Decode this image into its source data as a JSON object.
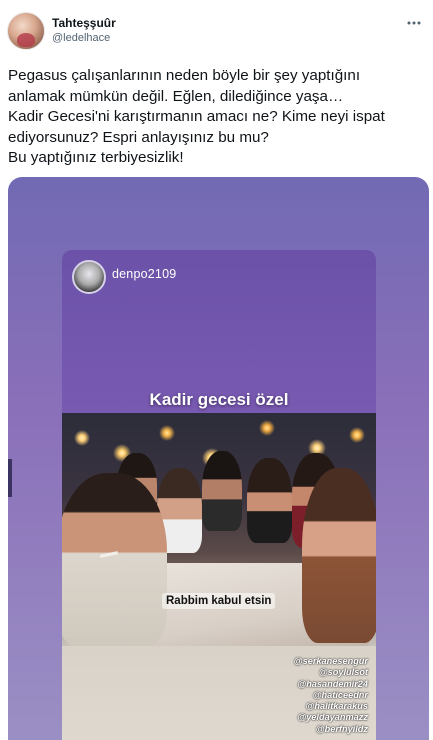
{
  "tweet": {
    "display_name": "Tahteşşuûr",
    "handle": "@ledelhace",
    "text_lines": [
      "Pegasus çalışanlarının neden böyle bir şey yaptığını",
      "anlamak mümkün değil. Eğlen, dilediğince yaşa…",
      "Kadir Gecesi'ni karıştırmanın amacı ne? Kime neyi ispat",
      "ediyorsunuz? Espri anlayışınız bu mu?",
      "Bu yaptığınız terbiyesizlik!"
    ]
  },
  "icons": {
    "more": "more-horizontal-icon",
    "avatar": "profile-avatar"
  },
  "story": {
    "username": "denpo2109",
    "title": "Kadir gecesi özel",
    "caption": "Rabbim kabul etsin",
    "tags": [
      "@serkanesengur",
      "@soylulsot",
      "@hasandemir24",
      "@haticeednr",
      "@halitkarakus",
      "@yeldayanmazz",
      "@berfnyildz"
    ]
  },
  "colors": {
    "text_primary": "#0f1419",
    "text_secondary": "#536471",
    "story_bg": "#7a5ab3"
  }
}
